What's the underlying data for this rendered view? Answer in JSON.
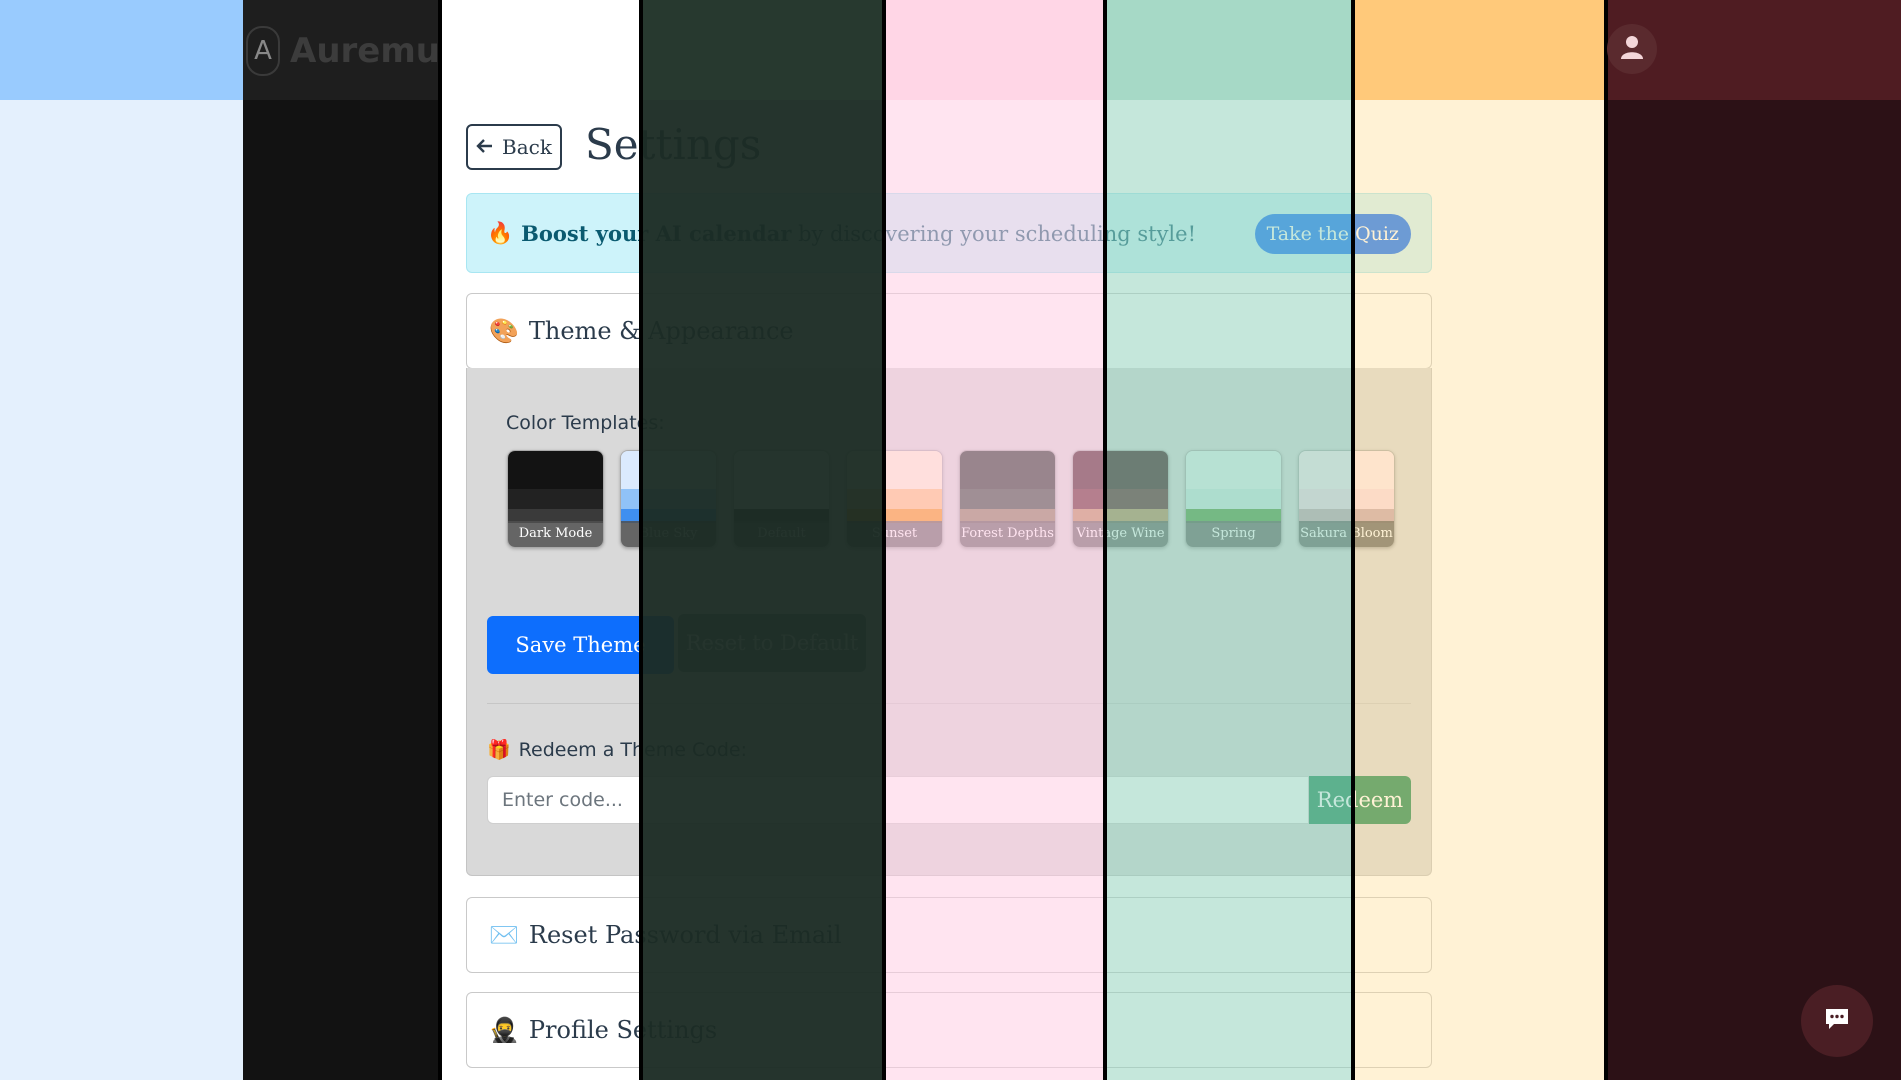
{
  "header": {
    "logo_text": "Auremu",
    "logo_glyph": "A"
  },
  "page": {
    "back_label": "Back",
    "title": "Settings"
  },
  "quiz_banner": {
    "emoji": "🔥",
    "bold_text": "Boost your AI calendar",
    "text": " by discovering your scheduling style!",
    "button_label": "Take the Quiz"
  },
  "theme_section": {
    "emoji": "🎨",
    "title": "Theme & Appearance",
    "templates_label": "Color Templates:",
    "templates": [
      {
        "name": "Dark Mode",
        "colors": [
          "#131313",
          "#222222",
          "#3a3a3a"
        ]
      },
      {
        "name": "Blue Sky",
        "colors": [
          "#dbeafe",
          "#90c2f7",
          "#3f8ff0"
        ]
      },
      {
        "name": "Default",
        "colors": [
          "#f6f6f6",
          "#ffffff",
          "#333333"
        ]
      },
      {
        "name": "Sunset",
        "colors": [
          "#fff4d6",
          "#ffc57a",
          "#f5960f"
        ]
      },
      {
        "name": "Forest Depths",
        "colors": [
          "#1e2e25",
          "#2e4436",
          "#8a7a5a"
        ]
      },
      {
        "name": "Vintage Wine",
        "colors": [
          "#3a151b",
          "#5c1f27",
          "#b88a5a"
        ]
      },
      {
        "name": "Spring Meadow",
        "colors": [
          "#dff2ee",
          "#cbe8e2",
          "#4e9a3f"
        ]
      },
      {
        "name": "Sakura Bloom",
        "colors": [
          "#fde8f0",
          "#fbd9e6",
          "#c9a4ad"
        ]
      }
    ],
    "save_label": "Save Theme",
    "reset_label": "Reset to Default",
    "redeem_emoji": "🎁",
    "redeem_label": "Redeem a Theme Code:",
    "code_placeholder": "Enter code...",
    "redeem_button": "Redeem"
  },
  "sections": [
    {
      "emoji": "✉️",
      "title": "Reset Password via Email"
    },
    {
      "emoji": "🥷",
      "title": "Profile Settings"
    }
  ],
  "theme_strip_colors": {
    "blue_sky": "#e4f0fd",
    "dark_mode": "#121212",
    "default": "#ffffff",
    "forest_depths": "#233329",
    "sakura_bloom": "#ffe6f0",
    "spring_meadow": "#dff2ee",
    "sunset": "#fff6df",
    "vintage_wine": "#2c1116"
  }
}
